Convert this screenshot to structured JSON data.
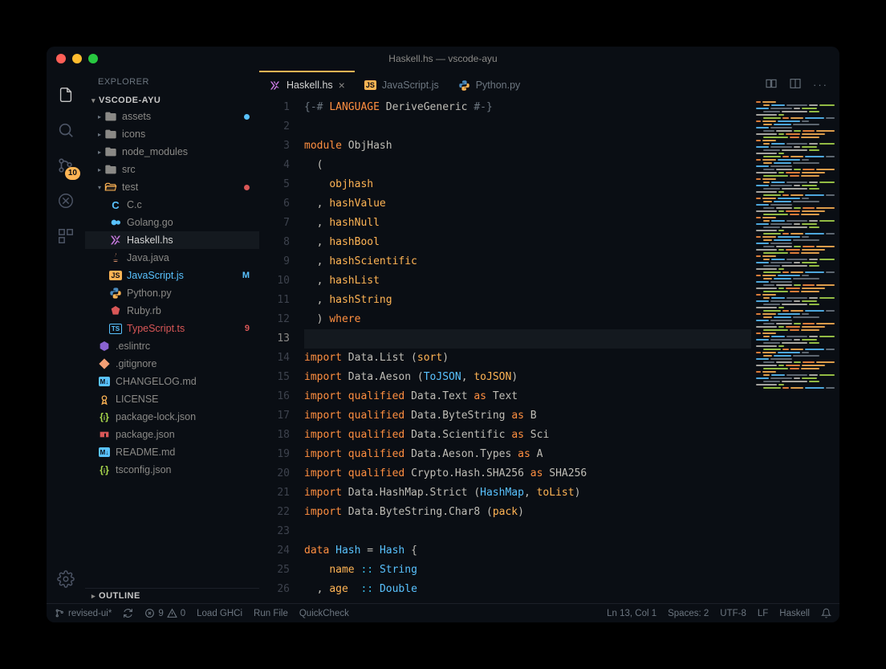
{
  "window": {
    "title": "Haskell.hs — vscode-ayu"
  },
  "sidebar": {
    "title": "EXPLORER",
    "workspace": "VSCODE-AYU",
    "outline": "OUTLINE"
  },
  "tree": [
    {
      "type": "folder",
      "depth": 1,
      "label": "assets",
      "icon": "folder",
      "decor_dot": "#59c2ff"
    },
    {
      "type": "folder",
      "depth": 1,
      "label": "icons",
      "icon": "folder"
    },
    {
      "type": "folder",
      "depth": 1,
      "label": "node_modules",
      "icon": "folder"
    },
    {
      "type": "folder",
      "depth": 1,
      "label": "src",
      "icon": "folder"
    },
    {
      "type": "folder",
      "depth": 1,
      "label": "test",
      "icon": "folder-open",
      "open": true,
      "decor_dot": "#d95757"
    },
    {
      "type": "file",
      "depth": 2,
      "label": "C.c",
      "icon": "c"
    },
    {
      "type": "file",
      "depth": 2,
      "label": "Golang.go",
      "icon": "go"
    },
    {
      "type": "file",
      "depth": 2,
      "label": "Haskell.hs",
      "icon": "haskell",
      "active": true
    },
    {
      "type": "file",
      "depth": 2,
      "label": "Java.java",
      "icon": "java"
    },
    {
      "type": "file",
      "depth": 2,
      "label": "JavaScript.js",
      "icon": "js",
      "decor": "M",
      "decor_color": "#59c2ff"
    },
    {
      "type": "file",
      "depth": 2,
      "label": "Python.py",
      "icon": "py"
    },
    {
      "type": "file",
      "depth": 2,
      "label": "Ruby.rb",
      "icon": "rb"
    },
    {
      "type": "file",
      "depth": 2,
      "label": "TypeScript.ts",
      "icon": "ts",
      "decor": "9",
      "decor_color": "#d95757"
    },
    {
      "type": "file",
      "depth": 1,
      "label": ".eslintrc",
      "icon": "eslint"
    },
    {
      "type": "file",
      "depth": 1,
      "label": ".gitignore",
      "icon": "git"
    },
    {
      "type": "file",
      "depth": 1,
      "label": "CHANGELOG.md",
      "icon": "md"
    },
    {
      "type": "file",
      "depth": 1,
      "label": "LICENSE",
      "icon": "license"
    },
    {
      "type": "file",
      "depth": 1,
      "label": "package-lock.json",
      "icon": "json"
    },
    {
      "type": "file",
      "depth": 1,
      "label": "package.json",
      "icon": "npm"
    },
    {
      "type": "file",
      "depth": 1,
      "label": "README.md",
      "icon": "md"
    },
    {
      "type": "file",
      "depth": 1,
      "label": "tsconfig.json",
      "icon": "json"
    }
  ],
  "tabs": [
    {
      "label": "Haskell.hs",
      "icon": "haskell",
      "active": true,
      "closeable": true
    },
    {
      "label": "JavaScript.js",
      "icon": "js"
    },
    {
      "label": "Python.py",
      "icon": "py"
    }
  ],
  "activitybar": {
    "badge": "10"
  },
  "code": {
    "lines": [
      [
        [
          "k-dim",
          "{-# "
        ],
        [
          "k-orange",
          "LANGUAGE"
        ],
        [
          "k-white",
          " DeriveGeneric "
        ],
        [
          "k-dim",
          "#-}"
        ]
      ],
      [],
      [
        [
          "k-orange",
          "module"
        ],
        [
          "k-white",
          " ObjHash"
        ]
      ],
      [
        [
          "k-white",
          "  ("
        ]
      ],
      [
        [
          "k-white",
          "    "
        ],
        [
          "k-yellow",
          "objhash"
        ]
      ],
      [
        [
          "k-white",
          "  , "
        ],
        [
          "k-yellow",
          "hashValue"
        ]
      ],
      [
        [
          "k-white",
          "  , "
        ],
        [
          "k-yellow",
          "hashNull"
        ]
      ],
      [
        [
          "k-white",
          "  , "
        ],
        [
          "k-yellow",
          "hashBool"
        ]
      ],
      [
        [
          "k-white",
          "  , "
        ],
        [
          "k-yellow",
          "hashScientific"
        ]
      ],
      [
        [
          "k-white",
          "  , "
        ],
        [
          "k-yellow",
          "hashList"
        ]
      ],
      [
        [
          "k-white",
          "  , "
        ],
        [
          "k-yellow",
          "hashString"
        ]
      ],
      [
        [
          "k-white",
          "  ) "
        ],
        [
          "k-orange",
          "where"
        ]
      ],
      [],
      [
        [
          "k-orange",
          "import"
        ],
        [
          "k-white",
          " Data.List ("
        ],
        [
          "k-yellow",
          "sort"
        ],
        [
          "k-white",
          ")"
        ]
      ],
      [
        [
          "k-orange",
          "import"
        ],
        [
          "k-white",
          " Data.Aeson ("
        ],
        [
          "k-blue",
          "ToJSON"
        ],
        [
          "k-white",
          ", "
        ],
        [
          "k-yellow",
          "toJSON"
        ],
        [
          "k-white",
          ")"
        ]
      ],
      [
        [
          "k-orange",
          "import "
        ],
        [
          "k-orange",
          "qualified"
        ],
        [
          "k-white",
          " Data.Text "
        ],
        [
          "k-orange",
          "as"
        ],
        [
          "k-white",
          " Text"
        ]
      ],
      [
        [
          "k-orange",
          "import "
        ],
        [
          "k-orange",
          "qualified"
        ],
        [
          "k-white",
          " Data.ByteString "
        ],
        [
          "k-orange",
          "as"
        ],
        [
          "k-white",
          " B"
        ]
      ],
      [
        [
          "k-orange",
          "import "
        ],
        [
          "k-orange",
          "qualified"
        ],
        [
          "k-white",
          " Data.Scientific "
        ],
        [
          "k-orange",
          "as"
        ],
        [
          "k-white",
          " Sci"
        ]
      ],
      [
        [
          "k-orange",
          "import "
        ],
        [
          "k-orange",
          "qualified"
        ],
        [
          "k-white",
          " Data.Aeson.Types "
        ],
        [
          "k-orange",
          "as"
        ],
        [
          "k-white",
          " A"
        ]
      ],
      [
        [
          "k-orange",
          "import "
        ],
        [
          "k-orange",
          "qualified"
        ],
        [
          "k-white",
          " Crypto.Hash.SHA256 "
        ],
        [
          "k-orange",
          "as"
        ],
        [
          "k-white",
          " SHA256"
        ]
      ],
      [
        [
          "k-orange",
          "import"
        ],
        [
          "k-white",
          " Data.HashMap.Strict ("
        ],
        [
          "k-blue",
          "HashMap"
        ],
        [
          "k-white",
          ", "
        ],
        [
          "k-yellow",
          "toList"
        ],
        [
          "k-white",
          ")"
        ]
      ],
      [
        [
          "k-orange",
          "import"
        ],
        [
          "k-white",
          " Data.ByteString.Char8 ("
        ],
        [
          "k-yellow",
          "pack"
        ],
        [
          "k-white",
          ")"
        ]
      ],
      [],
      [
        [
          "k-orange",
          "data"
        ],
        [
          "k-white",
          " "
        ],
        [
          "k-blue",
          "Hash"
        ],
        [
          "k-white",
          " = "
        ],
        [
          "k-blue",
          "Hash"
        ],
        [
          "k-white",
          " {"
        ]
      ],
      [
        [
          "k-white",
          "    "
        ],
        [
          "k-yellow",
          "name"
        ],
        [
          "k-white",
          " "
        ],
        [
          "k-cyan",
          "::"
        ],
        [
          "k-white",
          " "
        ],
        [
          "k-blue",
          "String"
        ]
      ],
      [
        [
          "k-white",
          "  , "
        ],
        [
          "k-yellow",
          "age "
        ],
        [
          "k-white",
          " "
        ],
        [
          "k-cyan",
          "::"
        ],
        [
          "k-white",
          " "
        ],
        [
          "k-blue",
          "Double"
        ]
      ]
    ],
    "current_line": 13
  },
  "status": {
    "branch": "revised-ui*",
    "errors": "9",
    "warnings": "0",
    "action1": "Load GHCi",
    "action2": "Run File",
    "action3": "QuickCheck",
    "cursor": "Ln 13, Col 1",
    "indent": "Spaces: 2",
    "encoding": "UTF-8",
    "eol": "LF",
    "language": "Haskell"
  },
  "icons": {
    "folder": "#8a8986",
    "c": "#59c2ff",
    "go": "#59c2ff",
    "haskell": "#c678dd",
    "java": "#f29e74",
    "js": "#ffb454",
    "py": "#ffb454",
    "rb": "#d95757",
    "ts": "#59c2ff",
    "eslint": "#8a63d2",
    "git": "#f29e74",
    "md": "#59c2ff",
    "license": "#ffb454",
    "json": "#aad94c",
    "npm": "#d95757"
  }
}
